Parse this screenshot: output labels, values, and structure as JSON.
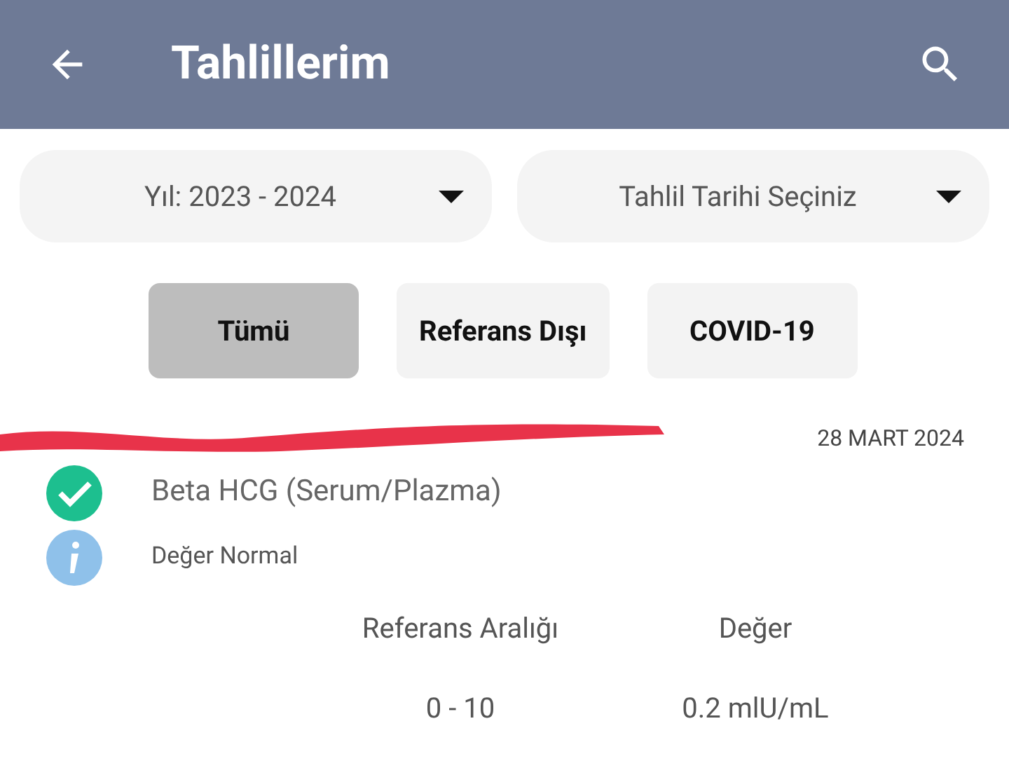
{
  "header": {
    "title": "Tahlillerim"
  },
  "dropdowns": [
    {
      "value": "Yıl: 2023 - 2024"
    },
    {
      "value": "Tahlil Tarihi Seçiniz"
    }
  ],
  "filters": [
    {
      "label": "Tümü",
      "selected": true
    },
    {
      "label": "Referans Dışı",
      "selected": false
    },
    {
      "label": "COVID-19",
      "selected": false
    }
  ],
  "results": [
    {
      "date": "28 MART 2024",
      "redacted": true,
      "test_name": "Beta HCG (Serum/Plazma)",
      "normal": true,
      "status": "Değer Normal",
      "columns": [
        "Referans Aralığı",
        "Değer"
      ],
      "values": [
        "0 - 10",
        "0.2 mlU/mL"
      ]
    }
  ]
}
